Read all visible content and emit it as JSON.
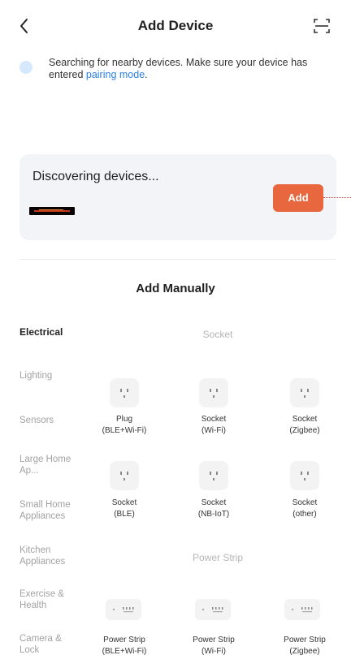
{
  "header": {
    "title": "Add Device",
    "back_icon": "chevron-left-icon",
    "scan_icon": "scan-icon"
  },
  "notice": {
    "icon": "bluetooth-search-icon",
    "text": "Searching for nearby devices. Make sure your device has entered ",
    "link": "pairing mode",
    "tail": "."
  },
  "discover": {
    "title": "Discovering devices...",
    "add_label": "Add"
  },
  "manual": {
    "title": "Add Manually"
  },
  "categories": [
    {
      "label": "Electrical",
      "active": true
    },
    {
      "label": "Lighting",
      "active": false
    },
    {
      "label": "Sensors",
      "active": false
    },
    {
      "label": "Large Home Ap...",
      "active": false
    },
    {
      "label": "Small Home Appliances",
      "active": false
    },
    {
      "label": "Kitchen Appliances",
      "active": false
    },
    {
      "label": "Exercise & Health",
      "active": false
    },
    {
      "label": "Camera & Lock",
      "active": false
    }
  ],
  "sections": [
    {
      "title": "Socket",
      "items": [
        {
          "line1": "Plug",
          "line2": "(BLE+Wi-Fi)"
        },
        {
          "line1": "Socket",
          "line2": "(Wi-Fi)"
        },
        {
          "line1": "Socket",
          "line2": "(Zigbee)"
        },
        {
          "line1": "Socket",
          "line2": "(BLE)"
        },
        {
          "line1": "Socket",
          "line2": "(NB-IoT)"
        },
        {
          "line1": "Socket",
          "line2": "(other)"
        }
      ]
    },
    {
      "title": "Power Strip",
      "items": [
        {
          "line1": "Power Strip",
          "line2": "(BLE+Wi-Fi)"
        },
        {
          "line1": "Power Strip",
          "line2": "(Wi-Fi)"
        },
        {
          "line1": "Power Strip",
          "line2": "(Zigbee)"
        }
      ]
    }
  ],
  "colors": {
    "accent": "#e9673e",
    "link": "#2a7fe4",
    "card_bg": "#f3f4f8"
  }
}
